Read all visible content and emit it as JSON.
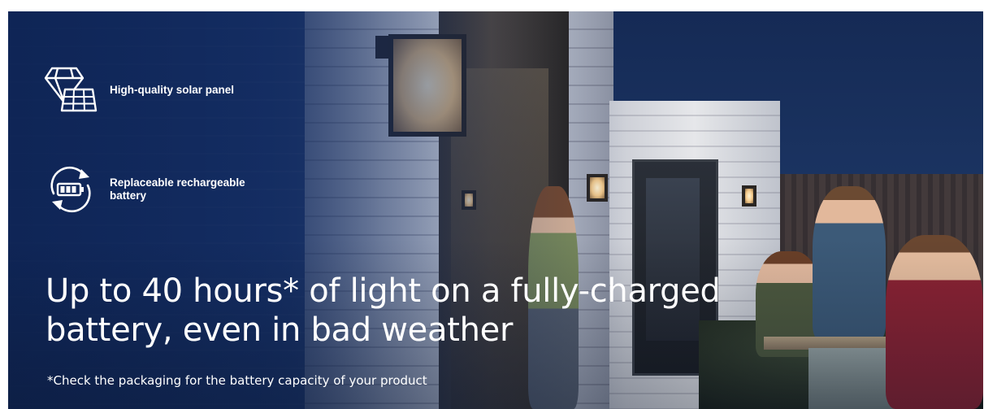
{
  "banner": {
    "features": [
      {
        "icon": "solar-panel-diamond-icon",
        "label": "High-quality solar panel"
      },
      {
        "icon": "rechargeable-battery-icon",
        "label": "Replaceable rechargeable battery"
      }
    ],
    "headline": "Up to 40 hours* of light on a fully-charged battery, even in bad weather",
    "footnote": "*Check the packaging for the battery capacity of your product"
  },
  "colors": {
    "overlay": "#10285c",
    "text": "#ffffff"
  }
}
